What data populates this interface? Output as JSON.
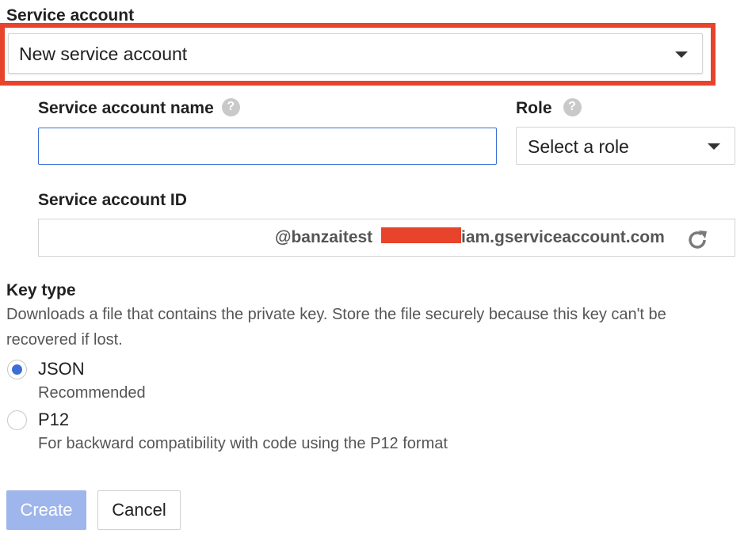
{
  "service_account": {
    "label": "Service account",
    "selected": "New service account",
    "highlight_color": "#e8432b"
  },
  "service_account_name": {
    "label": "Service account name",
    "help_icon": "question-circle-icon",
    "value": ""
  },
  "role": {
    "label": "Role",
    "help_icon": "question-circle-icon",
    "selected": "Select a role"
  },
  "service_account_id": {
    "label": "Service account ID",
    "prefix": "@banzaitest",
    "suffix": "iam.gserviceaccount.com",
    "redaction_color": "#e8432b",
    "refresh_icon": "refresh-icon"
  },
  "key_type": {
    "label": "Key type",
    "description": "Downloads a file that contains the private key. Store the file securely because this key can't be recovered if lost.",
    "options": [
      {
        "label": "JSON",
        "sublabel": "Recommended",
        "selected": true
      },
      {
        "label": "P12",
        "sublabel": "For backward compatibility with code using the P12 format",
        "selected": false
      }
    ]
  },
  "actions": {
    "create_label": "Create",
    "cancel_label": "Cancel"
  },
  "colors": {
    "accent": "#3b6fd6",
    "create_button_disabled": "#9fb6ec"
  }
}
